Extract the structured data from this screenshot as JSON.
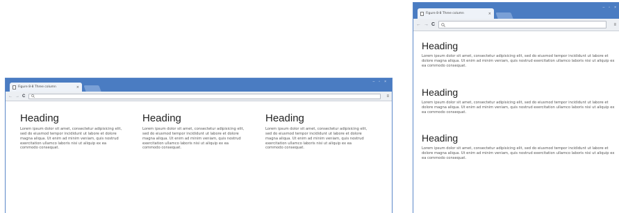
{
  "windows": [
    {
      "tab_title": "Figure 8-8 Three column",
      "tab_close": "×",
      "nav": {
        "back": "←",
        "forward": "→",
        "reload": "C"
      },
      "search_icon": "magnifier-icon",
      "menu_icon": "≡",
      "window_controls": [
        "–",
        "▫",
        "×"
      ],
      "columns": [
        {
          "heading": "Heading",
          "body": "Lorem ipsum dolor sit amet, consectetur adipisicing elit, sed do eiusmod tempor incididunt ut labore et dolore magna aliqua. Ut enim ad minim veniam, quis nostrud exercitation ullamco laboris nisi ut aliquip ex ea commodo consequat."
        },
        {
          "heading": "Heading",
          "body": "Lorem ipsum dolor sit amet, consectetur adipisicing elit, sed do eiusmod tempor incididunt ut labore et dolore magna aliqua. Ut enim ad minim veniam, quis nostrud exercitation ullamco laboris nisi ut aliquip ex ea commodo consequat."
        },
        {
          "heading": "Heading",
          "body": "Lorem ipsum dolor sit amet, consectetur adipisicing elit, sed do eiusmod tempor incididunt ut labore et dolore magna aliqua. Ut enim ad minim veniam, quis nostrud exercitation ullamco laboris nisi ut aliquip ex ea commodo consequat."
        }
      ]
    },
    {
      "tab_title": "Figure 8-8 Three column",
      "tab_close": "×",
      "nav": {
        "back": "←",
        "forward": "→",
        "reload": "C"
      },
      "search_icon": "magnifier-icon",
      "menu_icon": "≡",
      "window_controls": [
        "–",
        "▫",
        "×"
      ],
      "columns": [
        {
          "heading": "Heading",
          "body": "Lorem ipsum dolor sit amet, consectetur adipisicing elit, sed do eiusmod tempor incididunt ut labore et dolore magna aliqua. Ut enim ad minim veniam, quis nostrud exercitation ullamco laboris nisi ut aliquip ex ea commodo consequat."
        },
        {
          "heading": "Heading",
          "body": "Lorem ipsum dolor sit amet, consectetur adipisicing elit, sed do eiusmod tempor incididunt ut labore et dolore magna aliqua. Ut enim ad minim veniam, quis nostrud exercitation ullamco laboris nisi ut aliquip ex ea commodo consequat."
        },
        {
          "heading": "Heading",
          "body": "Lorem ipsum dolor sit amet, consectetur adipisicing elit, sed do eiusmod tempor incididunt ut labore et dolore magna aliqua. Ut enim ad minim veniam, quis nostrud exercitation ullamco laboris nisi ut aliquip ex ea commodo consequat."
        }
      ]
    }
  ],
  "colors": {
    "titlebar": "#4a7cc2",
    "toolbar": "#eceff3",
    "heading": "#222222",
    "body_text": "#555555"
  }
}
